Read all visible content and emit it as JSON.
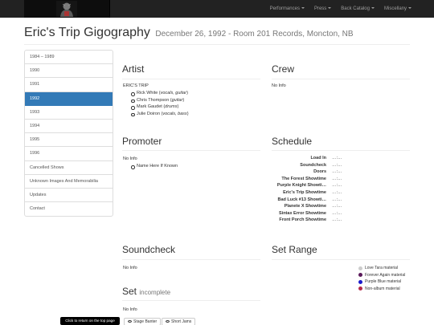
{
  "navbar": {
    "menu": [
      {
        "label": "Performances"
      },
      {
        "label": "Press"
      },
      {
        "label": "Back Catalog"
      },
      {
        "label": "Miscellany"
      }
    ]
  },
  "header": {
    "title": "Eric's Trip Gigography",
    "subtitle": "December 26, 1992 - Room 201 Records, Moncton, NB"
  },
  "sidebar": {
    "items": [
      {
        "label": "1984 – 1989",
        "active": false
      },
      {
        "label": "1990",
        "active": false
      },
      {
        "label": "1991",
        "active": false
      },
      {
        "label": "1992",
        "active": true
      },
      {
        "label": "1993",
        "active": false
      },
      {
        "label": "1994",
        "active": false
      },
      {
        "label": "1995",
        "active": false
      },
      {
        "label": "1996",
        "active": false
      },
      {
        "label": "Cancelled Shows",
        "active": false
      },
      {
        "label": "Unknown Images And Memorabilia",
        "active": false
      },
      {
        "label": "Updates",
        "active": false
      },
      {
        "label": "Contact",
        "active": false
      }
    ]
  },
  "artist": {
    "title": "Artist",
    "band": "ERIC'S TRIP",
    "members": [
      {
        "name": "Rick White",
        "role": "vocals, guitar"
      },
      {
        "name": "Chris Thompson",
        "role": "guitar"
      },
      {
        "name": "Mark Gaudet",
        "role": "drums"
      },
      {
        "name": "Julie Doiron",
        "role": "vocals, bass"
      }
    ]
  },
  "crew": {
    "title": "Crew",
    "info": "No Info"
  },
  "promoter": {
    "title": "Promoter",
    "info": "No Info",
    "item": "Name Here If Known"
  },
  "schedule": {
    "title": "Schedule",
    "rows": [
      {
        "label": "Load In",
        "time": "…:…"
      },
      {
        "label": "Soundcheck",
        "time": "…:…"
      },
      {
        "label": "Doors",
        "time": "…:…"
      },
      {
        "label": "The Forest Showtime",
        "time": "…:…"
      },
      {
        "label": "Purple Knight Showti…",
        "time": "…:…"
      },
      {
        "label": "Eric's Trip Showtime",
        "time": "…:…"
      },
      {
        "label": "Bad Luck #13 Showti…",
        "time": "…:…"
      },
      {
        "label": "Planete X Showtime",
        "time": "…:…"
      },
      {
        "label": "Sintax Error Showtime",
        "time": "…:…"
      },
      {
        "label": "Front Porch Showtime",
        "time": "…:…"
      }
    ]
  },
  "soundcheck": {
    "title": "Soundcheck",
    "info": "No Info"
  },
  "set_range": {
    "title": "Set Range",
    "legend": [
      {
        "label": "Love Tara material",
        "color": "#cccccc"
      },
      {
        "label": "Forever Again material",
        "color": "#5a1a5a"
      },
      {
        "label": "Purple Blue material",
        "color": "#1a1acc"
      },
      {
        "label": "Non-album material",
        "color": "#b52a4a"
      }
    ]
  },
  "set": {
    "title": "Set",
    "status": "incomplete",
    "info": "No Info"
  },
  "footer": {
    "tooltip": "Click to return on the top page",
    "buttons": [
      {
        "label": "Stage Banter"
      },
      {
        "label": "Short Jams"
      }
    ]
  }
}
